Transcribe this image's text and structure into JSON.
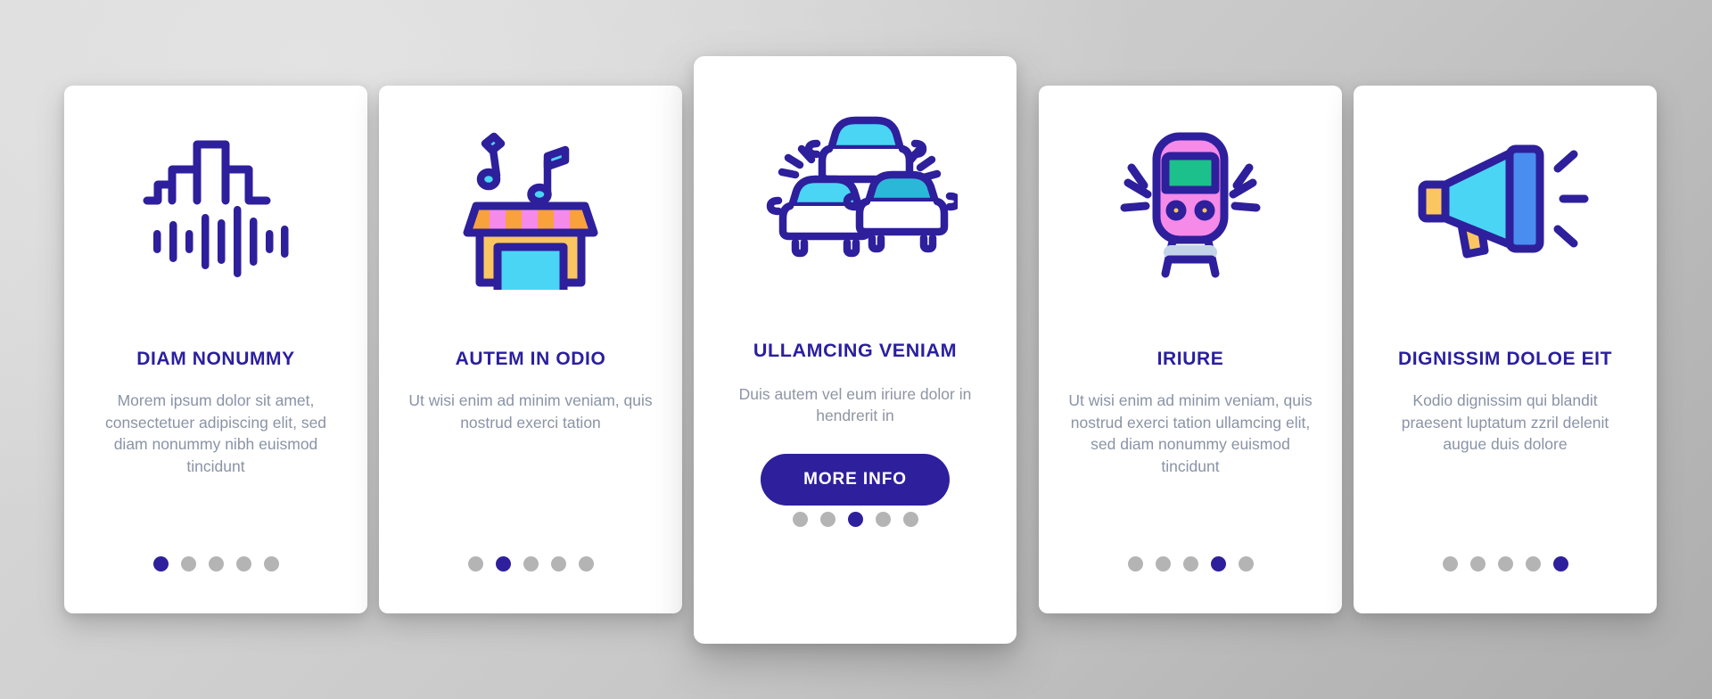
{
  "background": {
    "gradient_from": "#dcdcdc",
    "gradient_to": "#aeaeae"
  },
  "theme": {
    "accent": "#2e1f9c",
    "title_color": "#2a1f9e",
    "body_color": "#8a93a6",
    "dot_inactive": "#b4b4b4",
    "card_background": "#ffffff",
    "icon_cyan": "#4ad5f5",
    "icon_blue": "#4a8df0",
    "icon_orange": "#f9a13a",
    "icon_yellow": "#fbc661",
    "icon_pink": "#f58ae8",
    "icon_green": "#1cc08b",
    "icon_outline": "#2e1f9c"
  },
  "cards": [
    {
      "id": "card-diam-nonummy",
      "icon": "sound-wave-equalizer-icon",
      "title": "DIAM NONUMMY",
      "body": "Morem ipsum dolor sit amet, consectetuer adipiscing elit, sed diam nonummy nibh euismod tincidunt",
      "dots": {
        "total": 5,
        "active": 1
      },
      "featured": false
    },
    {
      "id": "card-autem-in-odio",
      "icon": "music-store-icon",
      "title": "AUTEM IN ODIO",
      "body": "Ut wisi enim ad minim veniam, quis nostrud exerci tation",
      "dots": {
        "total": 5,
        "active": 2
      },
      "featured": false
    },
    {
      "id": "card-ullamcing-veniam",
      "icon": "traffic-cars-icon",
      "title": "ULLAMCING VENIAM",
      "body": "Duis autem vel eum iriure dolor in hendrerit in",
      "button_label": "MORE INFO",
      "dots": {
        "total": 5,
        "active": 3
      },
      "featured": true
    },
    {
      "id": "card-iriure",
      "icon": "train-icon",
      "title": "IRIURE",
      "body": "Ut wisi enim ad minim veniam, quis nostrud exerci tation ullamcing elit, sed diam nonummy euismod tincidunt",
      "dots": {
        "total": 5,
        "active": 4
      },
      "featured": false
    },
    {
      "id": "card-dignissim-doloe-eit",
      "icon": "megaphone-icon",
      "title": "DIGNISSIM DOLOE EIT",
      "body": "Kodio dignissim qui blandit praesent luptatum zzril delenit augue duis dolore",
      "dots": {
        "total": 5,
        "active": 5
      },
      "featured": false
    }
  ]
}
